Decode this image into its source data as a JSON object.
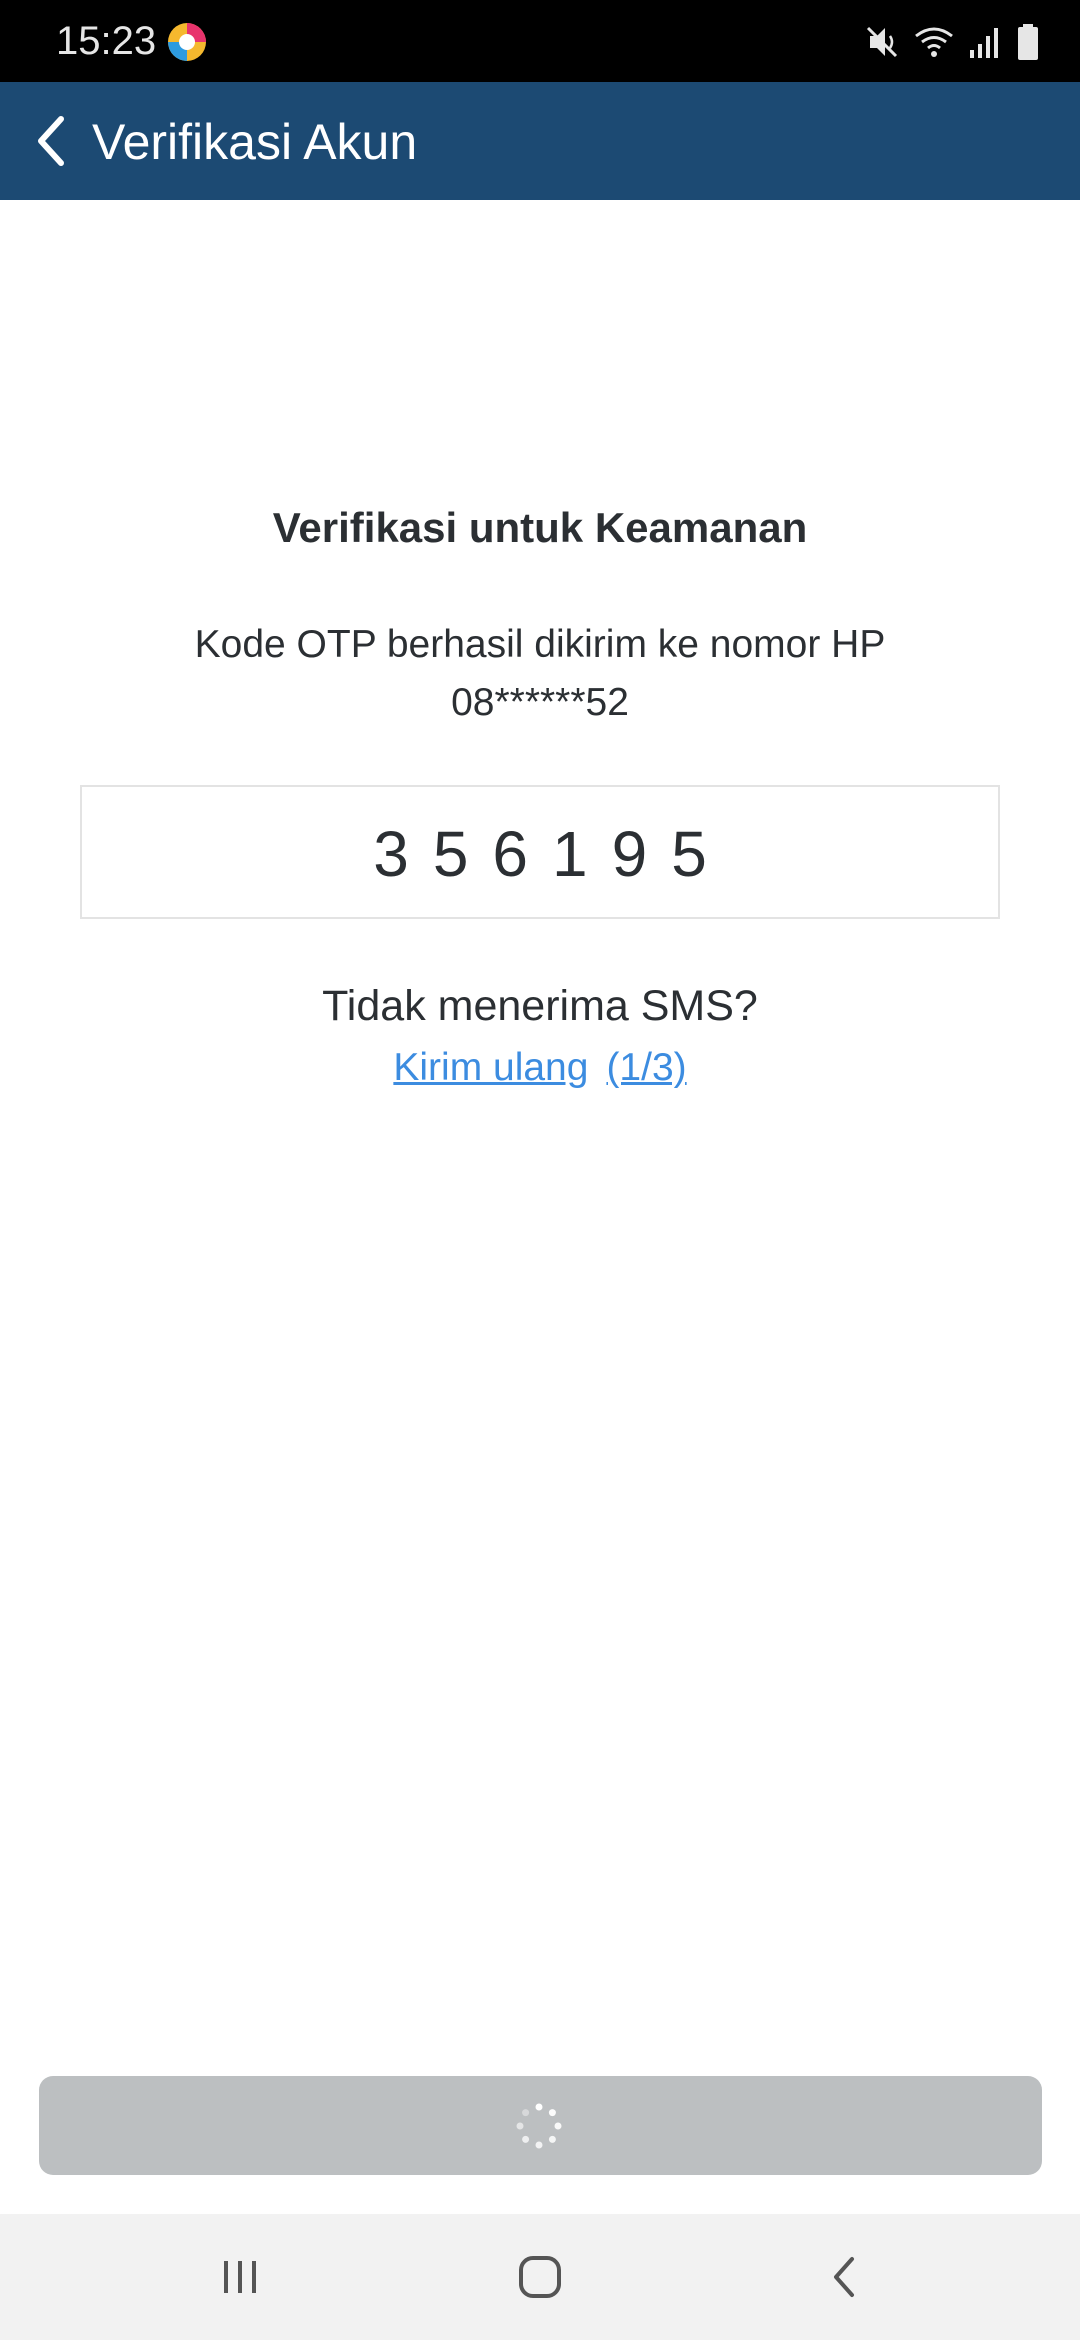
{
  "status_bar": {
    "time": "15:23",
    "icons": [
      "app-notification-icon",
      "mute-icon",
      "wifi-icon",
      "signal-icon",
      "battery-icon"
    ]
  },
  "app_bar": {
    "title": "Verifikasi Akun",
    "background": "#1c4a73"
  },
  "content": {
    "headline": "Verifikasi untuk Keamanan",
    "otp_message_line1": "Kode OTP berhasil dikirim ke nomor HP",
    "otp_message_line2": "08******52",
    "otp_value": "356195",
    "no_sms_text": "Tidak menerima SMS?",
    "resend_label": "Kirim ulang",
    "resend_count": "(1/3)",
    "link_color": "#3c8ce0"
  },
  "submit_button": {
    "state": "loading",
    "icon": "spinner-icon",
    "background": "#bcbfc1"
  },
  "nav_bar": {
    "buttons": [
      "recent-apps-icon",
      "home-icon",
      "back-icon"
    ]
  }
}
